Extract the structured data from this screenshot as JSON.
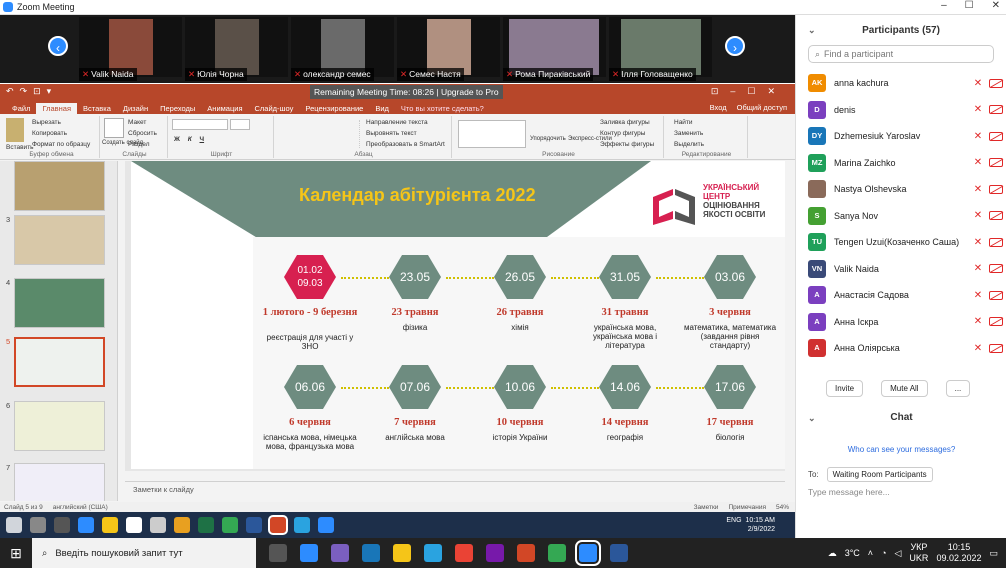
{
  "zoom": {
    "title": "Zoom Meeting",
    "remaining": "Remaining Meeting Time: 08:26 | Upgrade to Pro"
  },
  "videos": [
    {
      "name": "Valik Naida"
    },
    {
      "name": "Юлія Чорна"
    },
    {
      "name": "олександр семес"
    },
    {
      "name": "Семес Настя"
    },
    {
      "name": "Рома Пираківський"
    },
    {
      "name": "Ілля Головащенко"
    }
  ],
  "ppt": {
    "tabs": [
      "Файл",
      "Главная",
      "Вставка",
      "Дизайн",
      "Переходы",
      "Анимация",
      "Слайд-шоу",
      "Рецензирование",
      "Вид"
    ],
    "tell": "Что вы хотите сделать?",
    "login": "Вход",
    "share": "Общий доступ",
    "groups": [
      {
        "label": "Буфер обмена",
        "items": [
          "Вырезать",
          "Копировать",
          "Формат по образцу",
          "Вставить"
        ]
      },
      {
        "label": "Слайды",
        "items": [
          "Макет",
          "Сбросить",
          "Раздел",
          "Создать слайд"
        ]
      },
      {
        "label": "Шрифт",
        "items": [
          "Ж",
          "К",
          "Ч"
        ]
      },
      {
        "label": "Абзац",
        "items": [
          "Направление текста",
          "Выровнять текст",
          "Преобразовать в SmartArt"
        ]
      },
      {
        "label": "Рисование",
        "items": [
          "Упорядочить",
          "Экспресс-стили",
          "Заливка фигуры",
          "Контур фигуры",
          "Эффекты фигуры"
        ]
      },
      {
        "label": "Редактирование",
        "items": [
          "Найти",
          "Заменить",
          "Выделить"
        ]
      }
    ],
    "thumbs": [
      "",
      "3",
      "4",
      "5",
      "6",
      "7"
    ],
    "notes": "Заметки к слайду",
    "status_left": "Слайд 5 из 9",
    "status_lang": "английский (США)",
    "status_notes": "Заметки",
    "status_comments": "Примечания",
    "zoom_pct": "54%"
  },
  "slide": {
    "title": "Календар абітурієнта 2022",
    "logo": [
      "УКРАЇНСЬКИЙ",
      "ЦЕНТР",
      "ОЦІНЮВАННЯ",
      "ЯКОСТІ ОСВІТИ"
    ],
    "row1": [
      {
        "hex": "01.02\n09.03",
        "date": "1 лютого - 9 березня",
        "subj": "реєстрація для участі у ЗНО"
      },
      {
        "hex": "23.05",
        "date": "23 травня",
        "subj": "фізика"
      },
      {
        "hex": "26.05",
        "date": "26 травня",
        "subj": "хімія"
      },
      {
        "hex": "31.05",
        "date": "31 травня",
        "subj": "українська мова, українська мова і література"
      },
      {
        "hex": "03.06",
        "date": "3 червня",
        "subj": "математика, математика (завдання рівня стандарту)"
      }
    ],
    "row2": [
      {
        "hex": "06.06",
        "date": "6 червня",
        "subj": "іспанська мова, німецька мова, французька мова"
      },
      {
        "hex": "07.06",
        "date": "7 червня",
        "subj": "англійська мова"
      },
      {
        "hex": "10.06",
        "date": "10 червня",
        "subj": "історія України"
      },
      {
        "hex": "14.06",
        "date": "14 червня",
        "subj": "географія"
      },
      {
        "hex": "17.06",
        "date": "17 червня",
        "subj": "біологія"
      }
    ]
  },
  "participants": {
    "title": "Participants (57)",
    "search_placeholder": "Find a participant",
    "list": [
      {
        "initials": "AK",
        "name": "anna kachura",
        "color": "#f08c00"
      },
      {
        "initials": "D",
        "name": "denis",
        "color": "#7b3fbf"
      },
      {
        "initials": "DY",
        "name": "Dzhemesiuk Yaroslav",
        "color": "#1976b8"
      },
      {
        "initials": "MZ",
        "name": "Marina Zaichko",
        "color": "#1fa05a"
      },
      {
        "initials": "",
        "name": "Nastya Olshevska",
        "color": "#8a6a5a"
      },
      {
        "initials": "S",
        "name": "Sanya Nov",
        "color": "#44a032"
      },
      {
        "initials": "TU",
        "name": "Tengen Uzui(Козаченко Саша)",
        "color": "#1fa05a"
      },
      {
        "initials": "VN",
        "name": "Valik Naida",
        "color": "#3a4a78"
      },
      {
        "initials": "A",
        "name": "Анастасія Садова",
        "color": "#7b3fbf"
      },
      {
        "initials": "A",
        "name": "Анна Іскра",
        "color": "#7b3fbf"
      },
      {
        "initials": "A",
        "name": "Анна Оліярська",
        "color": "#d03030"
      }
    ],
    "invite": "Invite",
    "mute_all": "Mute All",
    "more": "...",
    "chat_title": "Chat",
    "who_see": "Who can see your messages?",
    "to_label": "To:",
    "to_value": "Waiting Room Participants",
    "message_placeholder": "Type message here..."
  },
  "inner_tray": {
    "time": "10:15 AM",
    "date": "2/9/2022",
    "lang": "ENG"
  },
  "taskbar": {
    "search": "Введіть пошуковий запит тут",
    "temp": "3°C",
    "lang1": "УКР",
    "lang2": "UKR",
    "time": "10:15",
    "date": "09.02.2022"
  }
}
